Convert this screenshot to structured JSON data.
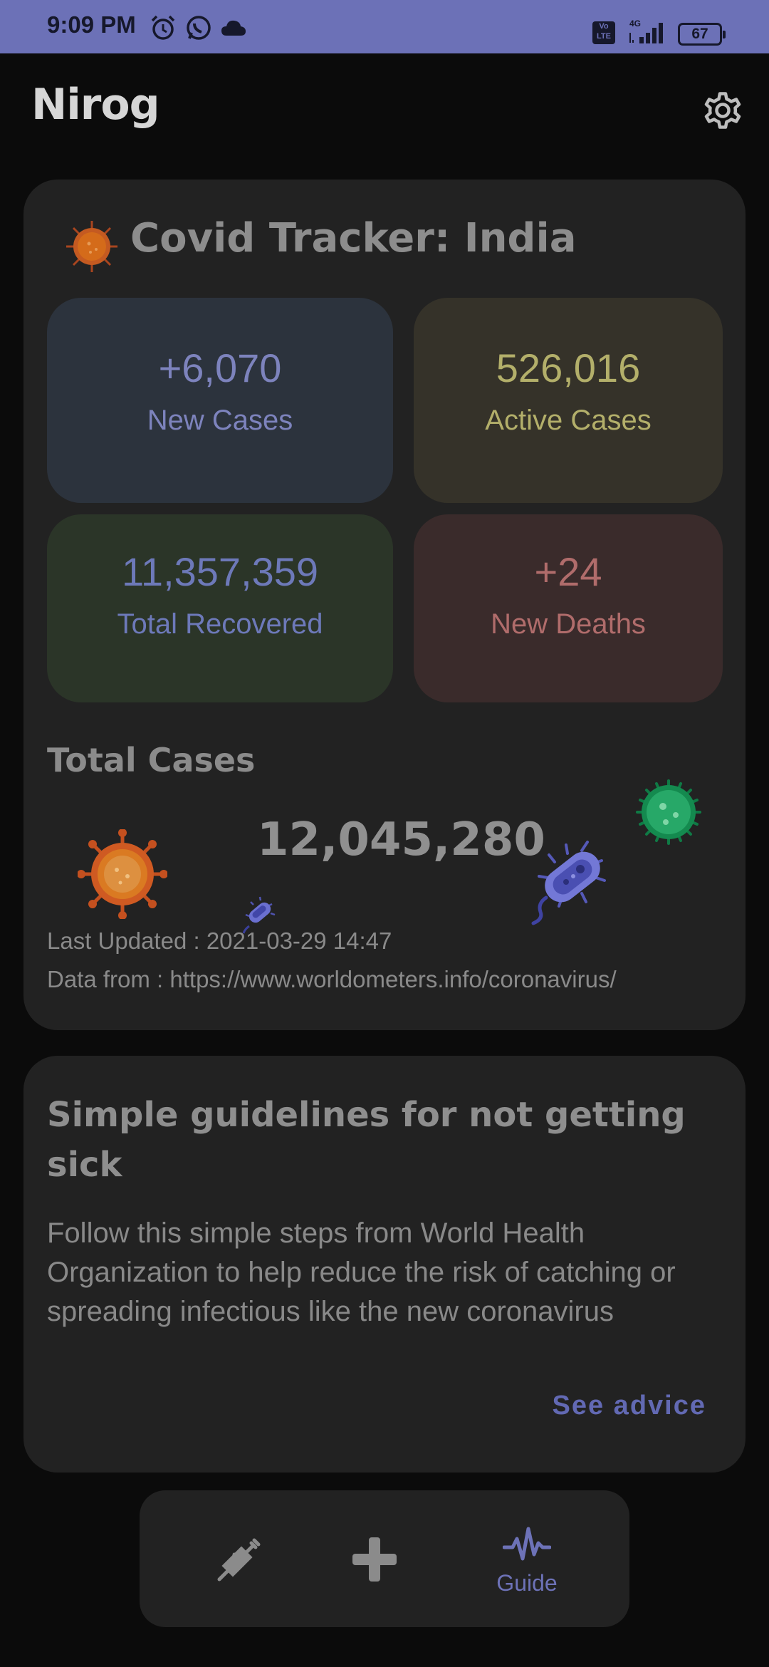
{
  "status_bar": {
    "time": "9:09 PM",
    "network": "4G",
    "volte": "Vo LTE",
    "battery": "67",
    "icons": [
      "alarm-icon",
      "whatsapp-icon",
      "cloud-icon",
      "signal-icon",
      "battery-icon"
    ]
  },
  "app": {
    "title": "Nirog",
    "settings_icon": "gear-icon"
  },
  "tracker": {
    "title": "Covid Tracker:  India",
    "title_icon": "virus-icon",
    "stats": {
      "new_cases": {
        "value": "+6,070",
        "label": "New Cases",
        "color": "#7d83bd"
      },
      "active_cases": {
        "value": "526,016",
        "label": "Active Cases",
        "color": "#b3af6a"
      },
      "total_recovered": {
        "value": "11,357,359",
        "label": "Total Recovered",
        "color": "#6d79b9"
      },
      "new_deaths": {
        "value": "+24",
        "label": "New Deaths",
        "color": "#b06c6b"
      }
    },
    "total_heading": "Total Cases",
    "total_value": "12,045,280",
    "last_updated": "Last Updated : 2021-03-29 14:47",
    "data_source": "Data from : https://www.worldometers.info/coronavirus/"
  },
  "guide": {
    "title": "Simple guidelines for not getting sick",
    "body": "Follow this simple steps from World Health Organization to help reduce the risk of catching or spreading infectious like the new coronavirus",
    "link": "See advice"
  },
  "nav": {
    "items": [
      {
        "icon": "syringe-icon"
      },
      {
        "icon": "plus-icon"
      },
      {
        "icon": "pulse-icon",
        "label": "Guide"
      }
    ],
    "accent": "#6d72b7"
  }
}
